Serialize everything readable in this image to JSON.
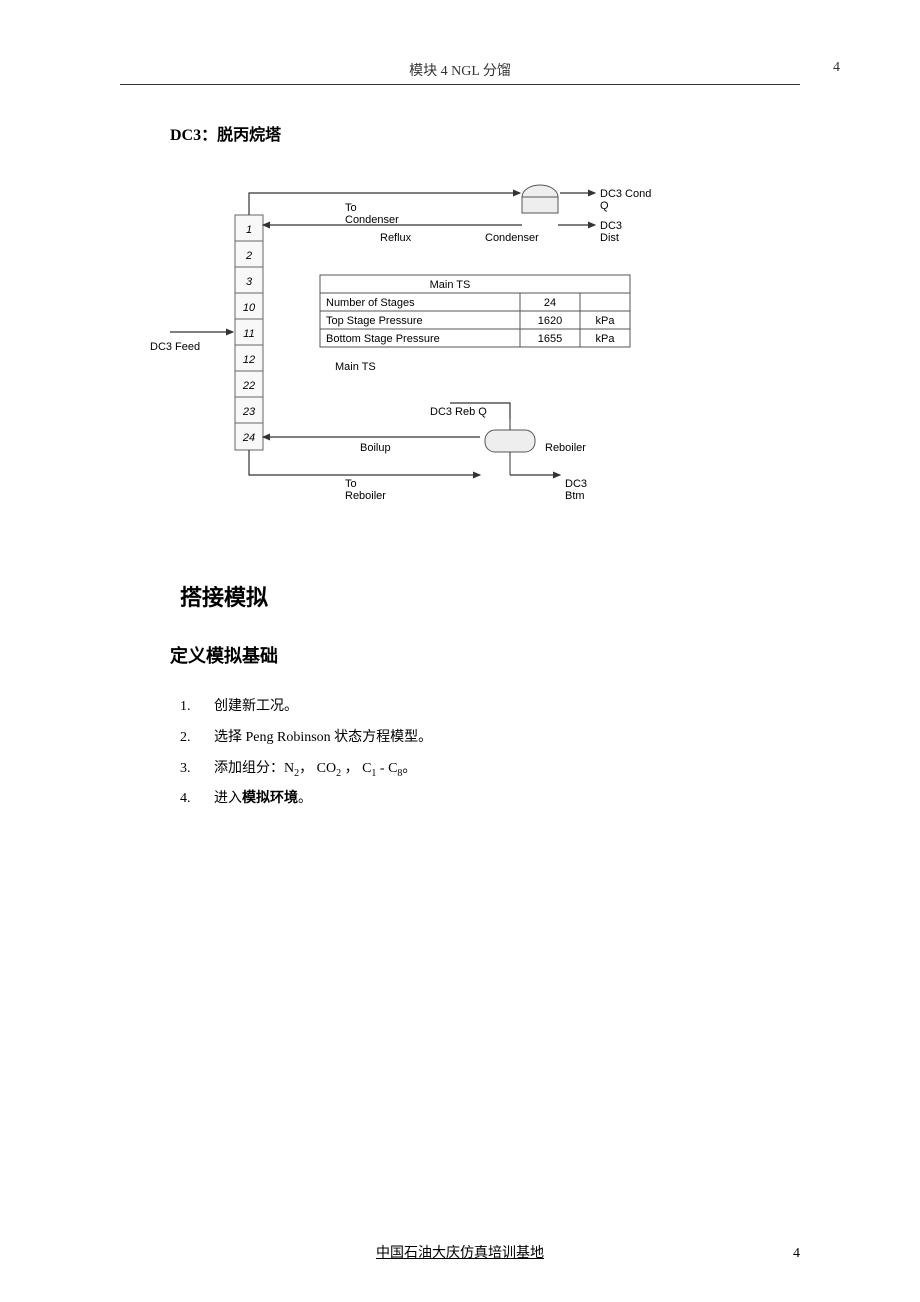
{
  "header": {
    "title": "模块 4  NGL 分馏",
    "page_top": "4"
  },
  "section": {
    "dc3_title": "DC3：脱丙烷塔"
  },
  "diagram": {
    "feed_label": "DC3 Feed",
    "to_condenser": "To",
    "to_condenser2": "Condenser",
    "reflux": "Reflux",
    "condenser": "Condenser",
    "dc3_cond_q": "DC3 Cond",
    "dc3_cond_q2": "Q",
    "dc3_dist": "DC3",
    "dc3_dist2": "Dist",
    "main_ts_title": "Main TS",
    "main_ts_label": "Main TS",
    "n_stages_label": "Number of Stages",
    "n_stages_val": "24",
    "top_p_label": "Top Stage Pressure",
    "top_p_val": "1620",
    "top_p_unit": "kPa",
    "bot_p_label": "Bottom Stage Pressure",
    "bot_p_val": "1655",
    "bot_p_unit": "kPa",
    "boilup": "Boilup",
    "to_reboiler": "To",
    "to_reboiler2": "Reboiler",
    "dc3_reb_q": "DC3 Reb Q",
    "reboiler": "Reboiler",
    "dc3_btm": "DC3",
    "dc3_btm2": "Btm",
    "stages": [
      "1",
      "2",
      "3",
      "10",
      "11",
      "12",
      "22",
      "23",
      "24"
    ]
  },
  "body": {
    "h1": "搭接模拟",
    "h2": "定义模拟基础",
    "steps": [
      "创建新工况。",
      "选择 Peng Robinson 状态方程模型。",
      "添加组分：N₂， CO₂ ， C₁ - C₈。",
      "进入模拟环境。"
    ],
    "step4_prefix": "进入",
    "step4_bold": "模拟环境",
    "step4_suffix": "。"
  },
  "footer": {
    "text": "中国石油大庆仿真培训基地",
    "page_bottom": "4"
  }
}
